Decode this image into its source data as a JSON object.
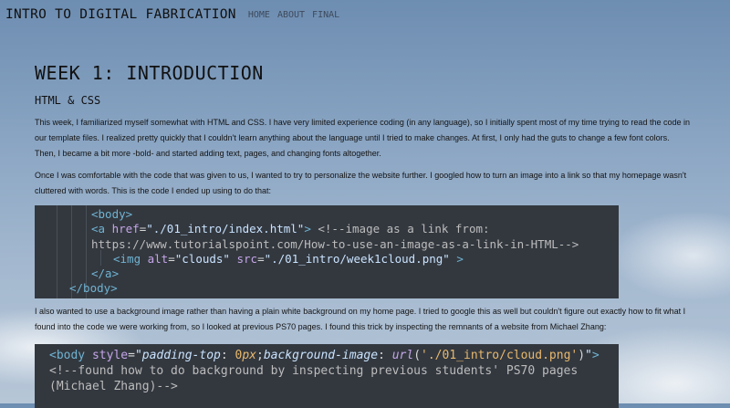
{
  "header": {
    "site_title": "INTRO TO DIGITAL FABRICATION",
    "nav": [
      "HOME",
      "ABOUT",
      "FINAL"
    ]
  },
  "page": {
    "title": "WEEK 1: INTRODUCTION",
    "subtitle": "HTML & CSS",
    "paragraph1": "This week, I familiarized myself somewhat with HTML and CSS. I have very limited experience coding (in any language), so I initially spent most of my time trying to read the code in our template files. I realized pretty quickly that I couldn't learn anything about the language until I tried to make changes. At first, I only had the guts to change a few font colors. Then, I became a bit more -bold- and started adding text, pages, and changing fonts altogether.",
    "paragraph2": "Once I was comfortable with the code that was given to us, I wanted to try to personalize the website further. I googled how to turn an image into a link so that my homepage wasn't cluttered with words. This is the code I ended up using to do that:",
    "paragraph3": "I also wanted to use a background image rather than having a plain white background on my home page. I tried to google this as well but couldn't figure out exactly how to fit what I found into the code we were working from, so I looked at previous PS70 pages. I found this trick by inspecting the remnants of a website from Michael Zhang:"
  },
  "code1": {
    "l1_tag": "<body>",
    "l2_open": "<a",
    "l2_attr": " href",
    "l2_eq": "=",
    "l2_str": "\"./01_intro/index.html\"",
    "l2_close": ">",
    "l2_comment": " <!--image as a link from:",
    "l3_comment": "https://www.tutorialspoint.com/How-to-use-an-image-as-a-link-in-HTML-->",
    "l4_open": "<img",
    "l4_attr1": " alt",
    "l4_eq1": "=",
    "l4_str1": "\"clouds\"",
    "l4_attr2": " src",
    "l4_eq2": "=",
    "l4_str2": "\"./01_intro/week1cloud.png\"",
    "l4_close": " >",
    "l5_tag": "</a>",
    "l6_tag": "</body>"
  },
  "code2": {
    "l1_open": "<body",
    "l1_attr": " style",
    "l1_eq": "=",
    "l1_q1": "\"",
    "l1_prop1": "padding-top",
    "l1_colon1": ": ",
    "l1_num": "0",
    "l1_unit": "px",
    "l1_semi": ";",
    "l1_prop2": "background-image",
    "l1_colon2": ": ",
    "l1_fn": "url",
    "l1_paren_open": "(",
    "l1_url": "'./01_intro/cloud.png'",
    "l1_paren_close": ")",
    "l1_q2": "\"",
    "l1_close": ">",
    "l2_comment": "<!--found how to do background by inspecting previous students' PS70 pages",
    "l3_comment": "(Michael Zhang)-->"
  },
  "colors": {
    "code_background": "#33383f",
    "tag": "#6fb3d2",
    "attribute": "#c5a5e8",
    "string": "#c9e3ff",
    "number": "#e8b86d"
  }
}
